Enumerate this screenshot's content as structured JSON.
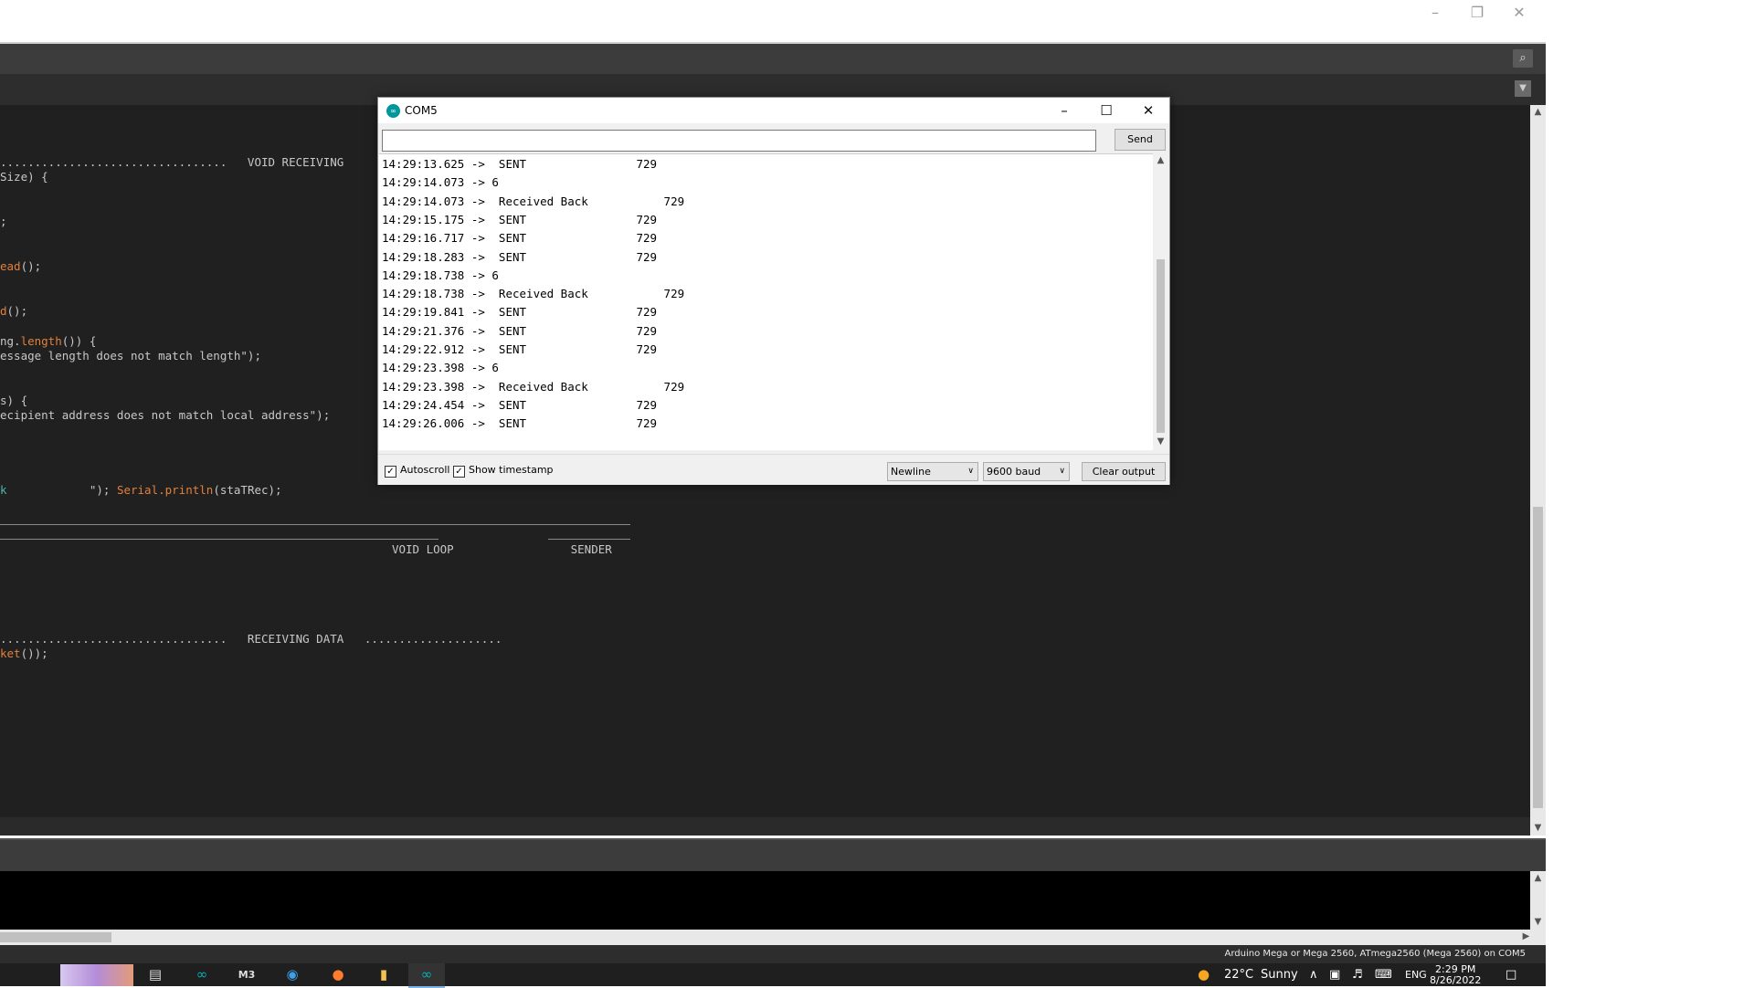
{
  "window_controls": {
    "minimize": "–",
    "maximize": "❐",
    "close": "✕"
  },
  "editor": {
    "code_lines": [
      {
        "text": ".................................   VOID RECEIVING",
        "color": "#c8c8c8"
      },
      {
        "text": "Size) {",
        "color": "#c8c8c8"
      },
      {
        "text": ";",
        "color": "#c8c8c8"
      },
      {
        "kw": "ead",
        "rest": "();"
      },
      {
        "kw": "d",
        "rest": "();"
      },
      {
        "pre": "ng.",
        "kw": "length",
        "rest": "()) {"
      },
      {
        "text": "essage length does not match length\");",
        "color": "#c8c8c8"
      },
      {
        "text": "s) {",
        "color": "#c8c8c8"
      },
      {
        "text": "ecipient address does not match local address\");",
        "color": "#c8c8c8"
      },
      {
        "teal": "k",
        "mid": "            \"); ",
        "kw": "Serial.println",
        "rest": "(staTRec);"
      },
      {
        "text": "                                                         VOID LOOP                 SENDER",
        "color": "#c8c8c8"
      },
      {
        "text": ".................................   RECEIVING DATA   ....................",
        "color": "#c8c8c8"
      },
      {
        "kw": "ket",
        "rest": "());"
      }
    ]
  },
  "serial_monitor": {
    "title": "COM5",
    "app_icon": "arduino-icon",
    "input_value": "",
    "send_label": "Send",
    "output_lines": [
      "14:29:13.625 ->  SENT                729",
      "14:29:14.073 -> 6",
      "14:29:14.073 ->  Received Back           729",
      "14:29:15.175 ->  SENT                729",
      "14:29:16.717 ->  SENT                729",
      "14:29:18.283 ->  SENT                729",
      "14:29:18.738 -> 6",
      "14:29:18.738 ->  Received Back           729",
      "14:29:19.841 ->  SENT                729",
      "14:29:21.376 ->  SENT                729",
      "14:29:22.912 ->  SENT                729",
      "14:29:23.398 -> 6",
      "14:29:23.398 ->  Received Back           729",
      "14:29:24.454 ->  SENT                729",
      "14:29:26.006 ->  SENT                729"
    ],
    "autoscroll_label": "Autoscroll",
    "autoscroll_checked": true,
    "timestamp_label": "Show timestamp",
    "timestamp_checked": true,
    "line_ending": "Newline",
    "baud_rate": "9600 baud",
    "clear_label": "Clear output"
  },
  "status_bar": {
    "board": "Arduino Mega or Mega 2560, ATmega2560 (Mega 2560) on COM5"
  },
  "taskbar": {
    "weather_temp": "22°C",
    "weather_text": "Sunny",
    "language": "ENG",
    "time": "2:29 PM",
    "date": "8/26/2022"
  }
}
